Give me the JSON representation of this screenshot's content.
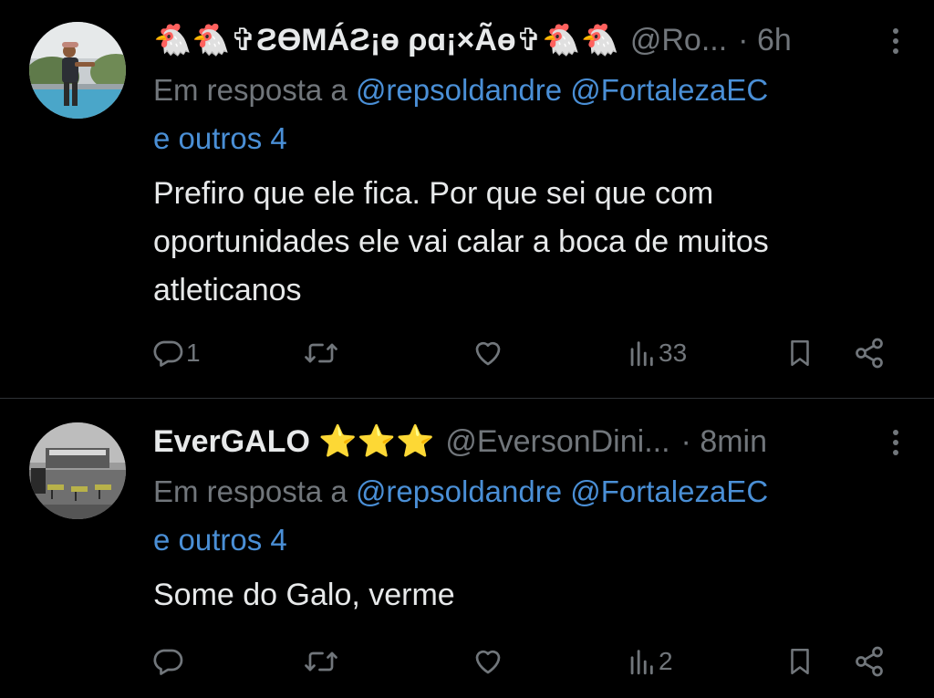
{
  "tweets": [
    {
      "display_name": "🐔🐔✞ƧƟMÁƧ¡ɵ ρɑ¡×Ãɵ✞🐔🐔",
      "handle": "@Ro...",
      "time": "· 6h",
      "reply_prefix": "Em resposta a",
      "mention_1": "@repsoldandre",
      "mention_2": "@FortalezaEC",
      "others": "e outros 4",
      "text": "Prefiro que ele fica. Por que sei que com oportunidades ele vai calar a boca de muitos atleticanos",
      "reply_count": "1",
      "retweet_count": "",
      "like_count": "",
      "views_count": "33"
    },
    {
      "display_name": "EverGALO ⭐⭐⭐",
      "handle": "@EversonDini...",
      "time": "· 8min",
      "reply_prefix": "Em resposta a",
      "mention_1": "@repsoldandre",
      "mention_2": "@FortalezaEC",
      "others": "e outros 4",
      "text": "Some do Galo, verme",
      "reply_count": "",
      "retweet_count": "",
      "like_count": "",
      "views_count": "2"
    }
  ],
  "icons": {
    "reply": "reply-icon",
    "retweet": "retweet-icon",
    "like": "heart-icon",
    "views": "views-icon",
    "bookmark": "bookmark-icon",
    "share": "share-icon",
    "more": "more-vertical-icon"
  },
  "colors": {
    "background": "#000000",
    "text_primary": "#e7e9ea",
    "text_secondary": "#71767b",
    "link": "#1d9bf0",
    "divider": "#2f3336"
  }
}
